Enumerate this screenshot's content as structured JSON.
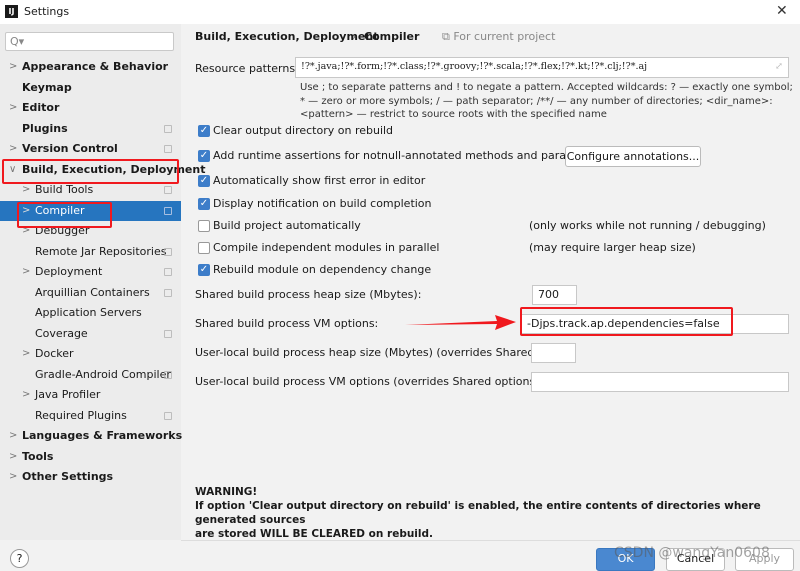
{
  "window": {
    "title": "Settings",
    "close_icon": "close-icon"
  },
  "sidebar": {
    "search_placeholder": "Q▾",
    "items": [
      {
        "label": "Appearance & Behavior",
        "bold": true,
        "chev": ">",
        "depth": 0
      },
      {
        "label": "Keymap",
        "bold": true,
        "chev": "",
        "depth": 0
      },
      {
        "label": "Editor",
        "bold": true,
        "chev": ">",
        "depth": 0
      },
      {
        "label": "Plugins",
        "bold": true,
        "chev": "",
        "depth": 0,
        "copy": true
      },
      {
        "label": "Version Control",
        "bold": true,
        "chev": ">",
        "depth": 0,
        "copy": true
      },
      {
        "label": "Build, Execution, Deployment",
        "bold": true,
        "chev": "∨",
        "depth": 0
      },
      {
        "label": "Build Tools",
        "chev": ">",
        "depth": 1,
        "copy": true
      },
      {
        "label": "Compiler",
        "chev": ">",
        "depth": 1,
        "copy": true,
        "selected": true
      },
      {
        "label": "Debugger",
        "chev": ">",
        "depth": 1
      },
      {
        "label": "Remote Jar Repositories",
        "chev": "",
        "depth": 1,
        "copy": true
      },
      {
        "label": "Deployment",
        "chev": ">",
        "depth": 1,
        "copy": true
      },
      {
        "label": "Arquillian Containers",
        "chev": "",
        "depth": 1,
        "copy": true
      },
      {
        "label": "Application Servers",
        "chev": "",
        "depth": 1
      },
      {
        "label": "Coverage",
        "chev": "",
        "depth": 1,
        "copy": true
      },
      {
        "label": "Docker",
        "chev": ">",
        "depth": 1
      },
      {
        "label": "Gradle-Android Compiler",
        "chev": "",
        "depth": 1,
        "copy": true
      },
      {
        "label": "Java Profiler",
        "chev": ">",
        "depth": 1
      },
      {
        "label": "Required Plugins",
        "chev": "",
        "depth": 1,
        "copy": true
      },
      {
        "label": "Languages & Frameworks",
        "bold": true,
        "chev": ">",
        "depth": 0
      },
      {
        "label": "Tools",
        "bold": true,
        "chev": ">",
        "depth": 0
      },
      {
        "label": "Other Settings",
        "bold": true,
        "chev": ">",
        "depth": 0
      }
    ]
  },
  "breadcrumb": {
    "parent": "Build, Execution, Deployment",
    "sep": "›",
    "current": "Compiler",
    "scope": "⧉ For current project"
  },
  "resource": {
    "label": "Resource patterns:",
    "value": "!?*.java;!?*.form;!?*.class;!?*.groovy;!?*.scala;!?*.flex;!?*.kt;!?*.clj;!?*.aj",
    "help": "Use ; to separate patterns and ! to negate a pattern. Accepted wildcards: ? — exactly one symbol; * — zero or more symbols; / — path separator; /**/ — any number of directories; <dir_name>:<pattern> — restrict to source roots with the specified name"
  },
  "options": [
    {
      "label": "Clear output directory on rebuild",
      "checked": true
    },
    {
      "label": "Add runtime assertions for notnull-annotated methods and parameters",
      "checked": true
    },
    {
      "label": "Automatically show first error in editor",
      "checked": true
    },
    {
      "label": "Display notification on build completion",
      "checked": true
    },
    {
      "label": "Build project automatically",
      "checked": false,
      "note": "(only works while not running / debugging)"
    },
    {
      "label": "Compile independent modules in parallel",
      "checked": false,
      "note": "(may require larger heap size)"
    },
    {
      "label": "Rebuild module on dependency change",
      "checked": true
    }
  ],
  "configure_button": "Configure annotations...",
  "fields": [
    {
      "label": "Shared build process heap size (Mbytes):",
      "value": "700"
    },
    {
      "label": "Shared build process VM options:",
      "value": "-Djps.track.ap.dependencies=false"
    },
    {
      "label": "User-local build process heap size (Mbytes) (overrides Shared size):",
      "value": ""
    },
    {
      "label": "User-local build process VM options (overrides Shared options):",
      "value": ""
    }
  ],
  "warning": {
    "title": "WARNING!",
    "line1": "If option 'Clear output directory on rebuild' is enabled, the entire contents of directories where generated sources",
    "line2": "are stored WILL BE CLEARED on rebuild."
  },
  "footer": {
    "help": "?",
    "ok": "OK",
    "cancel": "Cancel",
    "apply": "Apply"
  },
  "watermark": "CSDN @wangYan0608",
  "colors": {
    "selection": "#2675bf",
    "annotation_red": "#f0191e",
    "primary_button": "#4a88d0"
  }
}
